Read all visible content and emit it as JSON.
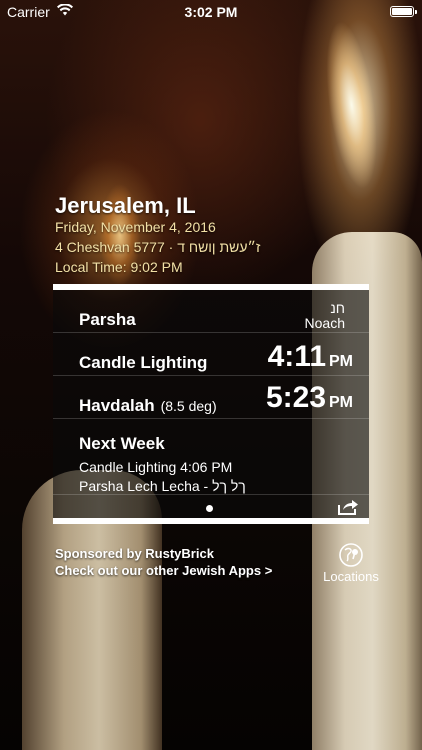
{
  "status_bar": {
    "carrier": "Carrier",
    "time": "3:02 PM",
    "wifi_icon": "wifi-icon",
    "battery_icon": "battery-icon"
  },
  "location": {
    "title": "Jerusalem, IL",
    "date": "Friday, November 4, 2016",
    "hebrew_date": "4 Cheshvan 5777 · ז״עשת ןושח ד",
    "local_time": "Local Time: 9:02 PM"
  },
  "panel": {
    "parsha": {
      "label": "Parsha",
      "value_hebrew": "חנ",
      "value": "Noach"
    },
    "candle_lighting": {
      "label": "Candle Lighting",
      "time": "4:11",
      "ampm": "PM"
    },
    "havdalah": {
      "label": "Havdalah",
      "sublabel": "(8.5 deg)",
      "time": "5:23",
      "ampm": "PM"
    },
    "next_week": {
      "label": "Next Week",
      "candle_lighting": "Candle Lighting 4:06 PM",
      "parsha": "Parsha Lech Lecha - ךל ךל"
    },
    "page_indicator_icon": "page-dot-icon",
    "share_icon": "share-icon"
  },
  "footer": {
    "sponsor": "Sponsored by RustyBrick",
    "apps_link": "Check out our other Jewish Apps >",
    "locations_label": "Locations",
    "locations_icon": "globe-pin-icon"
  }
}
